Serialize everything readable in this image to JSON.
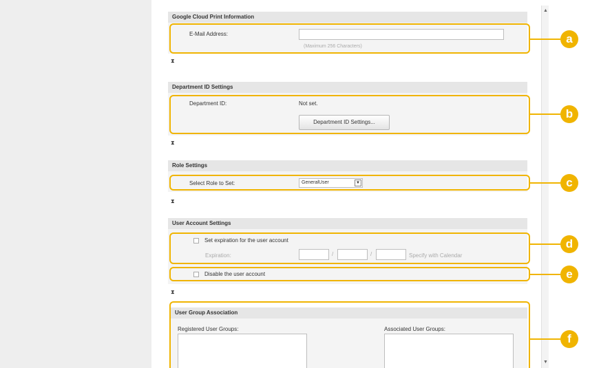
{
  "google_cloud": {
    "header": "Google Cloud Print Information",
    "email_label": "E-Mail Address:",
    "email_value": "",
    "email_hint": "(Maximum 256 Characters)"
  },
  "department": {
    "header": "Department ID Settings",
    "id_label": "Department ID:",
    "id_value": "Not set.",
    "button_label": "Department ID Settings..."
  },
  "role": {
    "header": "Role Settings",
    "select_label": "Select Role to Set:",
    "selected_role": "GeneralUser"
  },
  "account": {
    "header": "User Account Settings",
    "expiration_checkbox_label": "Set expiration for the user account",
    "expiration_label": "Expiration:",
    "date_separator": "/",
    "calendar_label": "Specify with Calendar",
    "disable_checkbox_label": "Disable the user account"
  },
  "groups": {
    "header": "User Group Association",
    "registered_label": "Registered User Groups:",
    "associated_label": "Associated User Groups:"
  },
  "callouts": [
    "a",
    "b",
    "c",
    "d",
    "e",
    "f"
  ],
  "icons": {
    "collapse": "hourglass-collapse-icon",
    "dropdown": "triangle-down-icon"
  },
  "colors": {
    "callout": "#f0b400"
  }
}
